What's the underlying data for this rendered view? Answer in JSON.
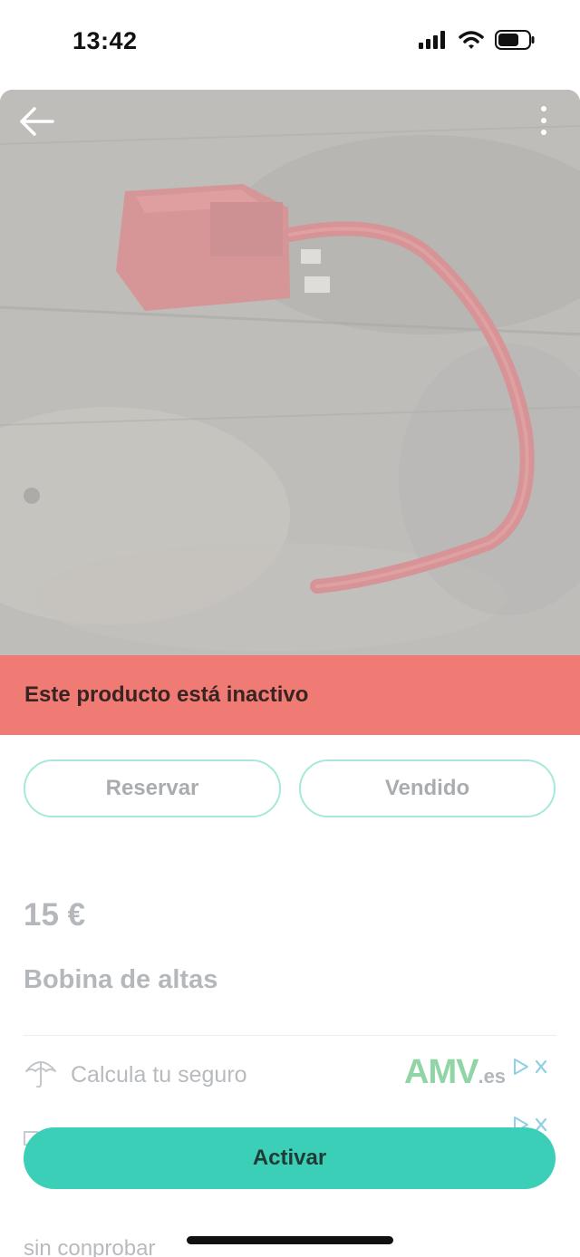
{
  "status_bar": {
    "time": "13:42"
  },
  "banner": {
    "text": "Este producto está inactivo"
  },
  "actions": {
    "reserve_label": "Reservar",
    "sold_label": "Vendido"
  },
  "product": {
    "price": "15 €",
    "title": "Bobina de altas"
  },
  "ad": {
    "text": "Calcula tu seguro",
    "brand": "AMV",
    "brand_suffix": ".es"
  },
  "primary": {
    "activate_label": "Activar"
  },
  "footer": {
    "partial_text": "sin conprobar"
  },
  "colors": {
    "banner": "#f07a74",
    "accent": "#3ccfb8",
    "pill_border": "#a8e7dc"
  }
}
